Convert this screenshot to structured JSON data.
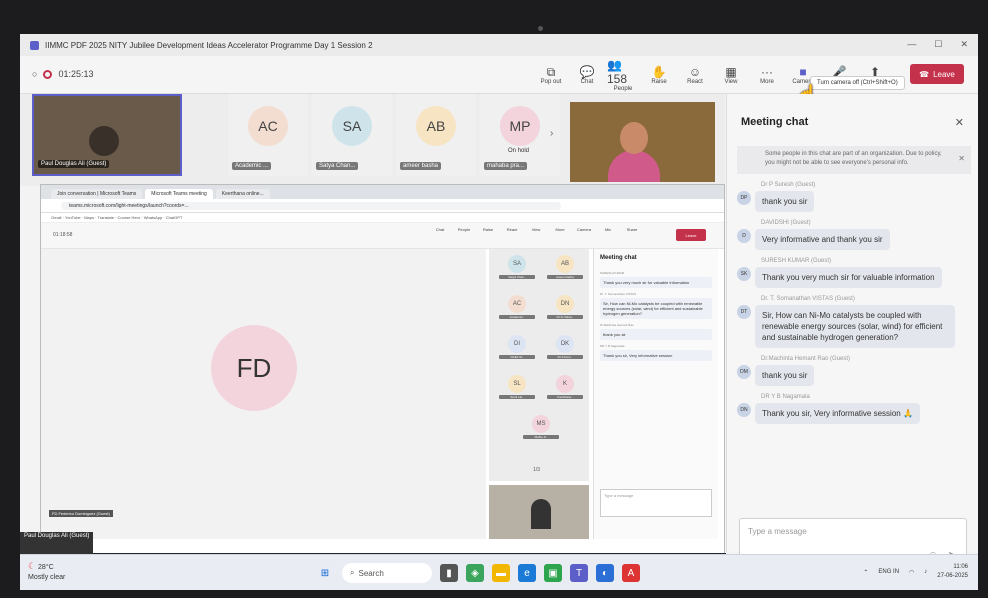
{
  "window": {
    "title": "IIMMC PDF 2025 NITY Jubilee Development Ideas Accelerator Programme Day 1 Session 2",
    "controls": [
      "—",
      "☐",
      "✕"
    ]
  },
  "toolbar": {
    "timer": "01:25:13",
    "items": [
      {
        "icon": "⧉",
        "label": "Pop out"
      },
      {
        "icon": "💬",
        "label": "Chat"
      },
      {
        "icon": "👥 158",
        "label": "People"
      },
      {
        "icon": "✋",
        "label": "Raise"
      },
      {
        "icon": "☺",
        "label": "React"
      },
      {
        "icon": "▦",
        "label": "View"
      },
      {
        "icon": "···",
        "label": "More"
      },
      {
        "icon": "■",
        "label": "Camera"
      },
      {
        "icon": "🎤",
        "label": "Mic"
      },
      {
        "icon": "⬆",
        "label": "Share"
      }
    ],
    "leave_label": "Leave",
    "tooltip": "Turn camera off (Ctrl+Shift+O)"
  },
  "participants": {
    "self_name": "Paul Douglas Ali (Guest)",
    "tiles": [
      {
        "initials": "AC",
        "name": "Academic ...",
        "color": "#f3ddd0"
      },
      {
        "initials": "SA",
        "name": "Satya Chan...",
        "color": "#cfe4ea"
      },
      {
        "initials": "AB",
        "name": "ameer basha",
        "color": "#f6e4c3"
      },
      {
        "initials": "MP",
        "name": "mahaba pra...",
        "color": "#f3d3dc",
        "status": "On hold"
      }
    ]
  },
  "shared_screen": {
    "browser_tabs": [
      "Join conversation | Microsoft Teams",
      "Microsoft Teams meeting",
      "Keerthana online..."
    ],
    "address": "teams.microsoft.com/light-meetings/launch?coords=...",
    "bookmarks": "Gmail · YouTube · Maps · Translate · Course Hero · WhatsApp · ChatGPT",
    "timer": "01:18:58",
    "tools": [
      "Chat",
      "People",
      "Raise",
      "React",
      "View",
      "More",
      "Camera",
      "Mic",
      "Share"
    ],
    "leave": "Leave",
    "speaker_initials": "FD",
    "stage_label": "FD Federico Dominguez (Guest)",
    "mini_tiles": [
      {
        "initials": "SA",
        "name": "Satya Chan..",
        "color": "#cfe4ea"
      },
      {
        "initials": "AB",
        "name": "ameer basha",
        "color": "#f6e4c3"
      },
      {
        "initials": "AC",
        "name": "Academic..",
        "color": "#f3ddd0"
      },
      {
        "initials": "DN",
        "name": "Dr N. Rana..",
        "color": "#f6e4c3"
      },
      {
        "initials": "DI",
        "name": "DCE1 M..",
        "color": "#dde4f3"
      },
      {
        "initials": "DK",
        "name": "Dr K.Kum..",
        "color": "#dde4f3"
      },
      {
        "initials": "SL",
        "name": "Sunil Lal..",
        "color": "#f6e4c3"
      },
      {
        "initials": "K",
        "name": "Kanchana..",
        "color": "#f3d3dc"
      },
      {
        "initials": "MS",
        "name": "Muthu S..",
        "color": "#f3d3dc"
      }
    ],
    "pager": "1/3",
    "chat_title": "Meeting chat",
    "chat_msgs": [
      {
        "who": "SURESH KUMAR",
        "text": "Thank you very much sir for valuable information"
      },
      {
        "who": "Dr. T. Somanathan VISTAS",
        "text": "Sir, How can Ni-Mo catalysts be coupled with renewable energy sources (solar, wind) for efficient and sustainable hydrogen generation?"
      },
      {
        "who": "Dr.Machinta Hemant Rao",
        "text": "thank you sir"
      },
      {
        "who": "DR Y B Nagamala",
        "text": "Thank you sir, Very informative session"
      }
    ],
    "chat_placeholder": "Type a message",
    "guest_label": "Paul Douglas Ali (Guest)"
  },
  "chat": {
    "title": "Meeting chat",
    "notice": "Some people in this chat are part of an organization. Due to policy, you might not be able to see everyone's personal info.",
    "messages": [
      {
        "who": "Dr P Suresh (Guest)",
        "initials": "DP",
        "text": "thank you sir"
      },
      {
        "who": "DAVIDSHI (Guest)",
        "initials": "D",
        "text": "Very informative and thank you sir"
      },
      {
        "who": "SURESH KUMAR (Guest)",
        "initials": "SK",
        "text": "Thank you very much sir for valuable information"
      },
      {
        "who": "Dr. T. Somanathan VISTAS (Guest)",
        "initials": "DT",
        "text": "Sir, How can Ni-Mo catalysts be coupled with renewable energy sources (solar, wind) for efficient and sustainable hydrogen generation?"
      },
      {
        "who": "Dr.Machinta Hemant Rao (Guest)",
        "initials": "DM",
        "text": "thank you sir"
      },
      {
        "who": "DR Y B Nagamala",
        "initials": "DN",
        "text": "Thank you sir, Very informative session 🙏"
      }
    ],
    "placeholder": "Type a message"
  },
  "taskbar": {
    "temp": "28°C",
    "weather": "Mostly clear",
    "search": "Search",
    "lang": "ENG IN",
    "time": "11:06",
    "date": "27-06-2025"
  }
}
